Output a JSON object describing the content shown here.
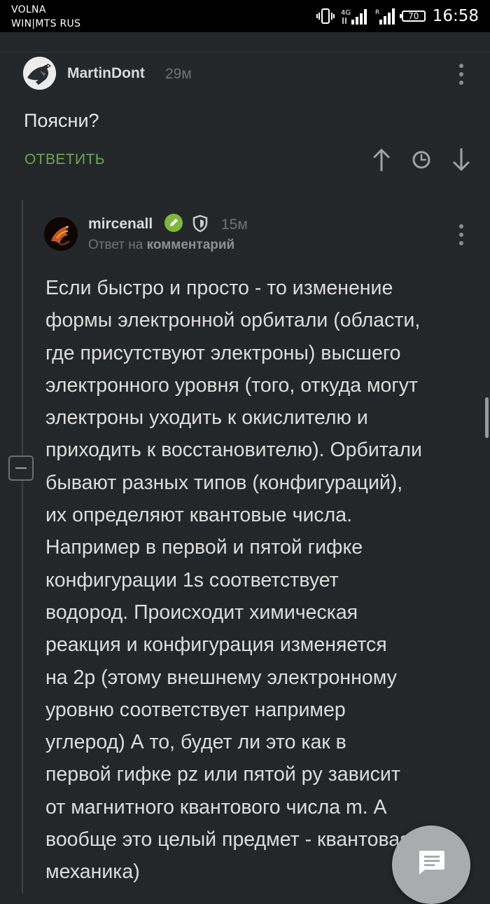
{
  "status_bar": {
    "carrier_line1": "VOLNA",
    "carrier_line2": "WIN|MTS RUS",
    "network_type": "4G",
    "roaming_marker": "R",
    "battery": "70",
    "time": "16:58",
    "icons": [
      "vibrate-icon",
      "signal-4g-icon",
      "signal-roaming-icon",
      "battery-icon"
    ]
  },
  "comments": [
    {
      "author": "MartinDont",
      "time": "29м",
      "text": "Поясни?",
      "reply_label": "ОТВЕТИТЬ",
      "actions": [
        "upvote-arrow-icon",
        "clock-icon",
        "downvote-arrow-icon"
      ]
    },
    {
      "author": "mircenall",
      "time": "15м",
      "reply_to_prefix": "Ответ на",
      "reply_to_target": "комментарий",
      "text": "Если быстро и просто - то изменение\nформы электронной орбитали (области,\nгде присутствуют электроны) высшего\nэлектронного уровня (того, откуда могут\nэлектроны уходить к окислителю и\nприходить к восстановителю). Орбитали\nбывают разных типов (конфигураций),\nих определяют квантовые числа.\nНапример в первой и пятой гифке\nконфигурации 1s соответствует\nводород. Происходит химическая\nреакция и конфигурация изменяется\nна 2p (этому внешнему электронному\nуровню соответствует например\nуглерод) А то, будет ли это как в\nпервой гифке pz или пятой py зависит\nот магнитного квантового числа m. А\nвообще это целый предмет - квантовая\nмеханика)",
      "badges": [
        "pencil-badge-icon",
        "shield-badge-icon"
      ]
    }
  ],
  "colors": {
    "background": "#24272a",
    "accent_green": "#6ea552",
    "muted": "#6f7478",
    "fab": "#a9abad"
  }
}
